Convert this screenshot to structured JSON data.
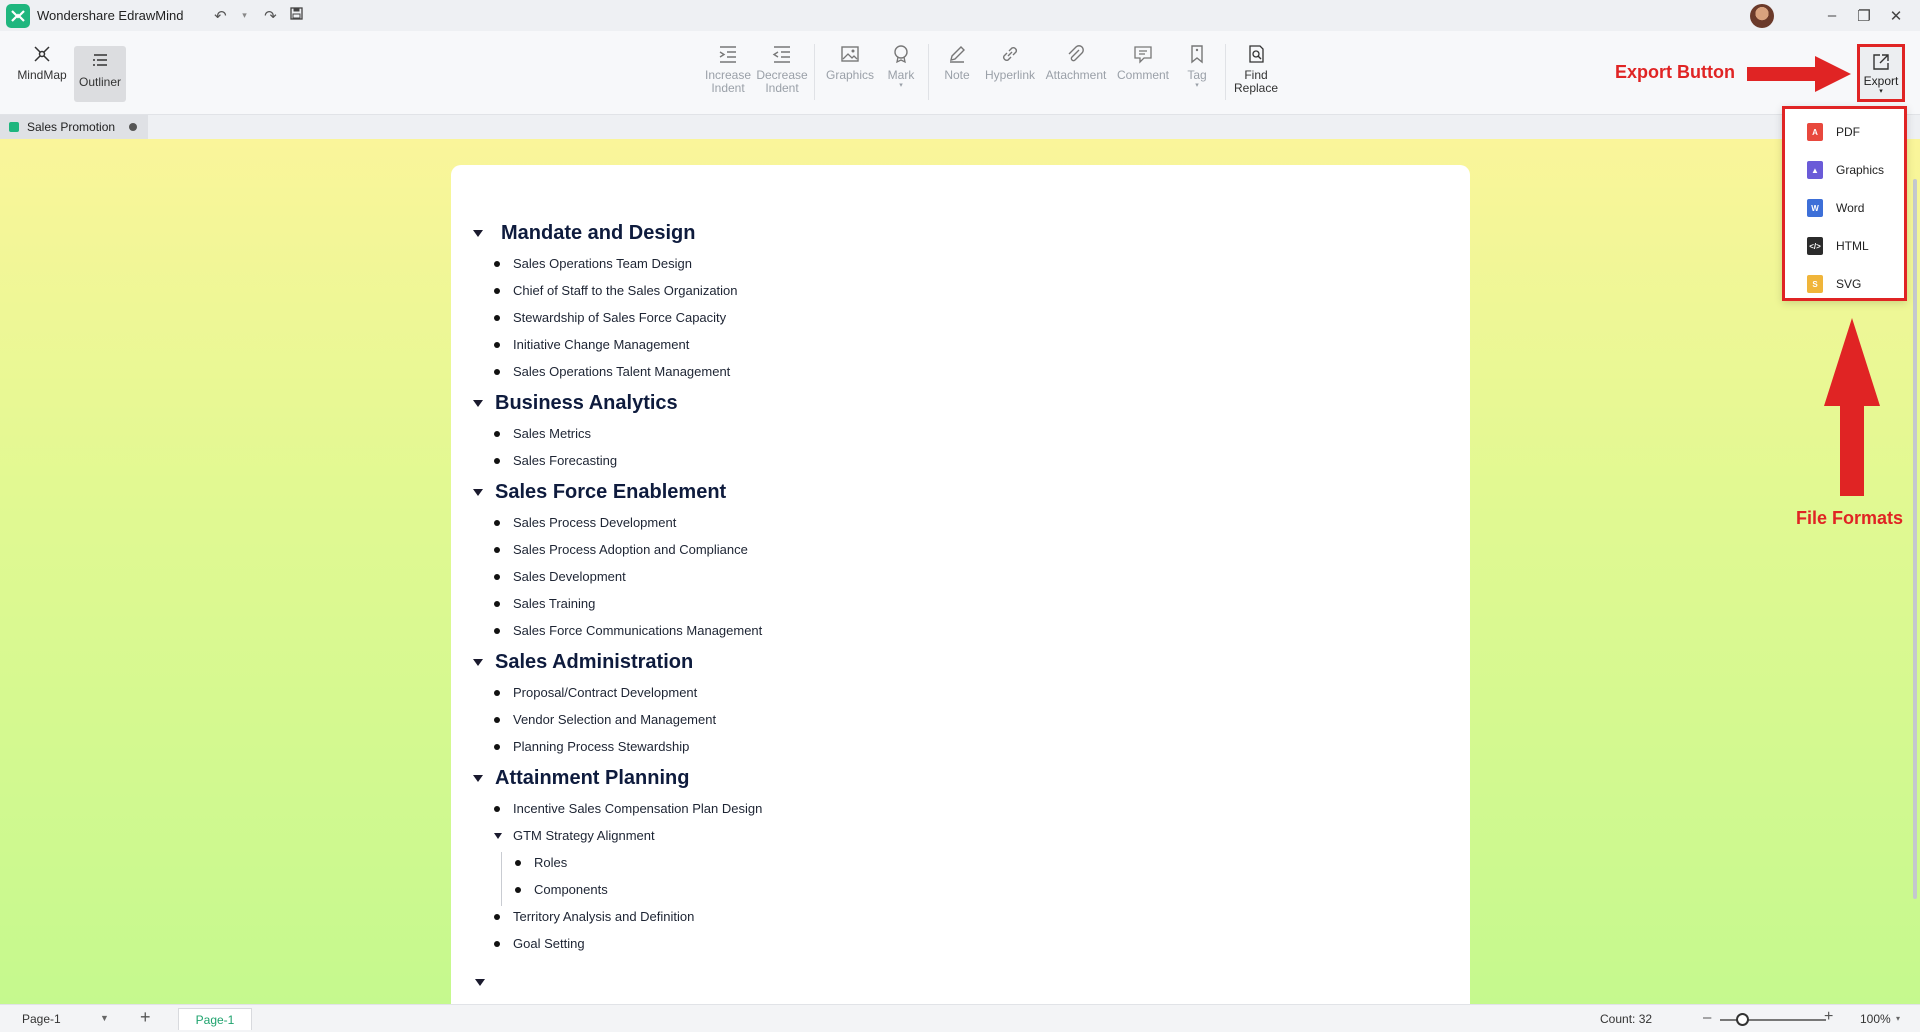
{
  "app": {
    "title": "Wondershare EdrawMind"
  },
  "ribbon": {
    "mindmap": "MindMap",
    "outliner": "Outliner",
    "increase_indent": "Increase\nIndent",
    "decrease_indent": "Decrease\nIndent",
    "graphics": "Graphics",
    "mark": "Mark",
    "note": "Note",
    "hyperlink": "Hyperlink",
    "attachment": "Attachment",
    "comment": "Comment",
    "tag": "Tag",
    "find_replace": "Find\nReplace",
    "export": "Export"
  },
  "doc_tab": {
    "title": "Sales Promotion"
  },
  "outline": {
    "topics": [
      {
        "title": "Mandate and Design",
        "items": [
          "Sales Operations Team Design",
          "Chief of Staff to the Sales Organization",
          "Stewardship of Sales Force Capacity",
          "Initiative Change Management",
          "Sales Operations Talent Management"
        ]
      },
      {
        "title": "Business Analytics",
        "items": [
          "Sales Metrics",
          "Sales Forecasting"
        ]
      },
      {
        "title": "Sales Force Enablement",
        "items": [
          "Sales Process Development",
          "Sales Process Adoption and Compliance",
          "Sales Development",
          "Sales Training",
          "Sales Force Communications Management"
        ]
      },
      {
        "title": "Sales Administration",
        "items": [
          "Proposal/Contract Development",
          "Vendor Selection and Management",
          "Planning Process Stewardship"
        ]
      },
      {
        "title": "Attainment Planning",
        "items": [
          "Incentive Sales Compensation Plan Design",
          "GTM Strategy Alignment",
          "Roles",
          "Components",
          "Territory Analysis and Definition",
          "Goal Setting"
        ]
      }
    ]
  },
  "export_menu": {
    "items": [
      {
        "label": "PDF",
        "color": "#e8483d"
      },
      {
        "label": "Graphics",
        "color": "#6a5bd8"
      },
      {
        "label": "Word",
        "color": "#3d6fd8"
      },
      {
        "label": "HTML",
        "color": "#2b2b2b"
      },
      {
        "label": "SVG",
        "color": "#f0b53a"
      }
    ]
  },
  "annotations": {
    "export_button": "Export Button",
    "file_formats": "File Formats"
  },
  "status": {
    "page_select": "Page-1",
    "page_tab": "Page-1",
    "count": "Count: 32",
    "zoom": "100%",
    "zoom_level": 0.22
  }
}
